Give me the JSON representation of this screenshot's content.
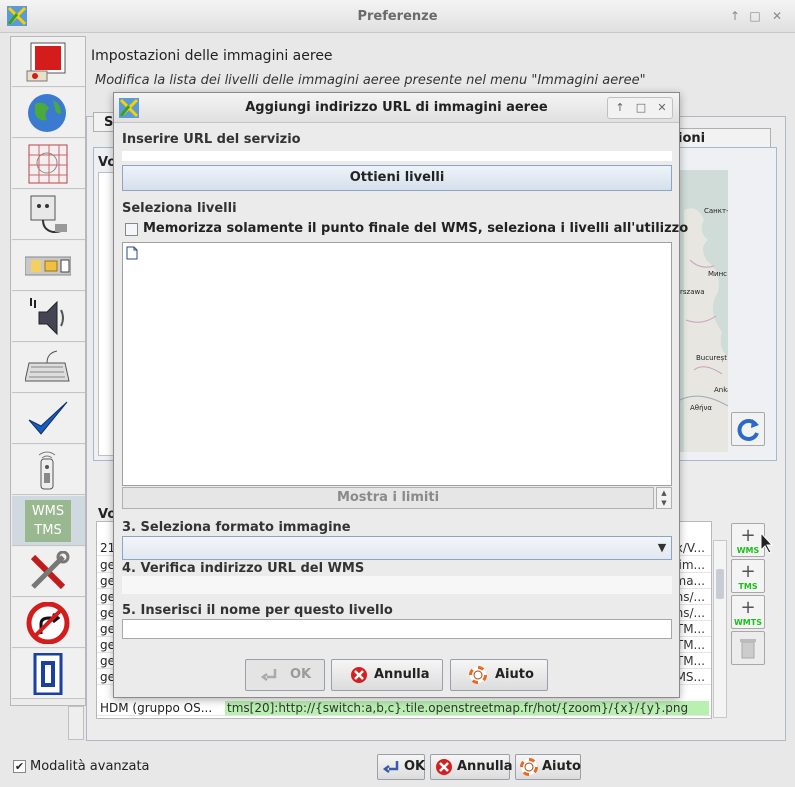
{
  "window": {
    "title": "Preferenze",
    "controls": [
      "↑",
      "□",
      "✕"
    ]
  },
  "left_tabs": [
    {
      "icon": "display-settings-icon"
    },
    {
      "icon": "globe-icon"
    },
    {
      "icon": "projection-grid-icon"
    },
    {
      "icon": "plugin-icon"
    },
    {
      "icon": "folder-toolbar-icon"
    },
    {
      "icon": "audio-icon"
    },
    {
      "icon": "keyboard-icon"
    },
    {
      "icon": "validator-checkmark-icon"
    },
    {
      "icon": "remote-control-icon"
    },
    {
      "icon": "imagery-wms-tms-icon",
      "label_line1": "WMS",
      "label_line2": "TMS",
      "selected": true
    },
    {
      "icon": "tools-icon"
    },
    {
      "icon": "no-turn-icon"
    },
    {
      "icon": "advanced-zero-icon"
    }
  ],
  "main": {
    "heading": "Impostazioni delle immagini aeree",
    "description": "Modifica la lista dei livelli delle immagini aeree presente nel menu \"Immagini aeree\"",
    "tab_partial": "S",
    "tab_partial_right": "ioni",
    "section1_label": "Vo",
    "section2_label": "Vo",
    "map_labels": [
      "Санкт-",
      "Минс",
      "rszawa",
      "Bucureșt",
      "Ankara",
      "Αθήνα"
    ],
    "table_rows": [
      {
        "c1": "21",
        "c2": "x/V..."
      },
      {
        "c1": "ge",
        "c2": "im..."
      },
      {
        "c1": "ge",
        "c2": "ma..."
      },
      {
        "c1": "ge",
        "c2": "ns/..."
      },
      {
        "c1": "ge",
        "c2": "ns/..."
      },
      {
        "c1": "ge",
        "c2": "TM..."
      },
      {
        "c1": "ge",
        "c2": "TM..."
      },
      {
        "c1": "ge",
        "c2": "TM..."
      },
      {
        "c1": "ge",
        "c2": "MS..."
      }
    ],
    "hdm_row": {
      "c1": "HDM (gruppo OS...",
      "c2": "tms[20]:http://{switch:a,b,c}.tile.openstreetmap.fr/hot/{zoom}/{x}/{y}.png"
    },
    "side_buttons": [
      {
        "icon": "add-wms-icon",
        "label": "WMS"
      },
      {
        "icon": "add-tms-icon",
        "label": "TMS"
      },
      {
        "icon": "add-wmts-icon",
        "label": "WMTS"
      },
      {
        "icon": "delete-icon",
        "label": ""
      }
    ]
  },
  "bottom": {
    "advanced_mode_label": "Modalità avanzata",
    "advanced_mode_checked": "✔",
    "ok_label": "OK",
    "cancel_label": "Annulla",
    "help_label": "Aiuto"
  },
  "dialog": {
    "title": "Aggiungi indirizzo URL di immagini aeree",
    "controls": [
      "↑",
      "□",
      "✕"
    ],
    "step1_label": "Inserire URL del servizio",
    "url_value": "",
    "get_layers_label": "Ottieni livelli",
    "select_layers_label": "Seleziona livelli",
    "store_endpoint_label": "Memorizza solamente il punto finale del WMS, seleziona i livelli all'utilizzo",
    "show_bounds_label": "Mostra i limiti",
    "step3_label": "3. Seleziona formato immagine",
    "format_value": "",
    "step4_label": "4. Verifica indirizzo URL del WMS",
    "step5_label": "5. Inserisci il nome per questo livello",
    "name_value": "",
    "ok_label": "OK",
    "cancel_label": "Annulla",
    "help_label": "Aiuto"
  },
  "colors": {
    "accent_green": "#1cc01c",
    "hdm_highlight": "#b8f0b0",
    "cancel_red": "#d42020",
    "help_orange": "#e86a20"
  }
}
